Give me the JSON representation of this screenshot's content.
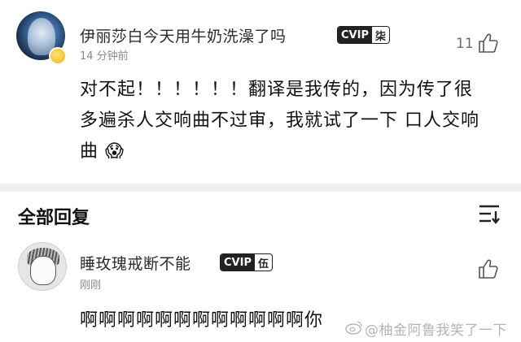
{
  "comment": {
    "username": "伊丽莎白今天用牛奶洗澡了吗",
    "vip_tag": "CVIP",
    "vip_level": "柒",
    "time": "14 分钟前",
    "likes": "11",
    "text": "对不起！！！！！！翻译是我传的，因为传了很多遍杀人交响曲不过审，我就试了一下 口人交响曲 😱"
  },
  "replies_section": {
    "title": "全部回复"
  },
  "reply": {
    "username": "睡玫瑰戒断不能",
    "vip_tag": "CVIP",
    "vip_level": "伍",
    "time": "刚刚",
    "text": "啊啊啊啊啊啊啊啊啊啊啊啊你"
  },
  "watermark": "@柚金阿鲁我笑了一下"
}
